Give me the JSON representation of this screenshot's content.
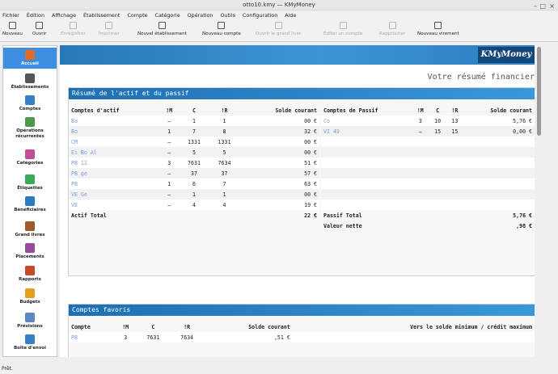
{
  "window": {
    "title": "otto10.kmy — KMyMoney"
  },
  "menu": [
    "Fichier",
    "Édition",
    "Affichage",
    "Établissement",
    "Compte",
    "Catégorie",
    "Opération",
    "Outils",
    "Configuration",
    "Aide"
  ],
  "toolbar": [
    {
      "label": "Nouveau",
      "enabled": true,
      "icon": "new-icon"
    },
    {
      "label": "Ouvrir",
      "enabled": true,
      "icon": "open-icon"
    },
    {
      "label": "Enregistrer",
      "enabled": false,
      "icon": "save-icon"
    },
    {
      "label": "Imprimer",
      "enabled": false,
      "icon": "print-icon"
    },
    {
      "label": "Nouvel établissement",
      "enabled": true,
      "icon": "institution-icon"
    },
    {
      "label": "Nouveau compte",
      "enabled": true,
      "icon": "account-icon"
    },
    {
      "label": "Ouvrir le grand livre",
      "enabled": false,
      "icon": "ledger-icon"
    },
    {
      "label": "Éditer un compte",
      "enabled": false,
      "icon": "edit-icon"
    },
    {
      "label": "Rapprocher",
      "enabled": false,
      "icon": "reconcile-icon"
    },
    {
      "label": "Nouveau virement",
      "enabled": true,
      "icon": "transfer-icon"
    }
  ],
  "sidebar": [
    {
      "label": "Accueil",
      "selected": true,
      "icon": "home-icon",
      "color": "#e06a2a"
    },
    {
      "label": "Établissements",
      "icon": "bank-icon",
      "color": "#555555"
    },
    {
      "label": "Comptes",
      "icon": "accounts-icon",
      "color": "#3a7fc4"
    },
    {
      "label": "Opérations récurrentes",
      "icon": "calendar-icon",
      "color": "#4a9a4a"
    },
    {
      "label": "Catégories",
      "icon": "categories-icon",
      "color": "#c44d9a"
    },
    {
      "label": "Étiquettes",
      "icon": "tag-icon",
      "color": "#3aa85a"
    },
    {
      "label": "Bénéficiaires",
      "icon": "payees-icon",
      "color": "#2a7ac4"
    },
    {
      "label": "Grand livres",
      "icon": "ledger-icon",
      "color": "#a05a2a"
    },
    {
      "label": "Placements",
      "icon": "investment-icon",
      "color": "#9a4a9a"
    },
    {
      "label": "Rapports",
      "icon": "reports-icon",
      "color": "#c44a2a"
    },
    {
      "label": "Budgets",
      "icon": "budget-icon",
      "color": "#e0a020"
    },
    {
      "label": "Prévisions",
      "icon": "forecast-icon",
      "color": "#5a8ac4"
    },
    {
      "label": "Boîte d'envoi",
      "icon": "outbox-icon",
      "color": "#3a7fc4"
    }
  ],
  "main": {
    "headline": "Votre résumé financier",
    "brand": "KMyMoney",
    "summary": {
      "title": "Résumé de l'actif et du passif",
      "asset_headers": [
        "Comptes d'actif",
        "!M",
        "C",
        "!R",
        "Solde courant"
      ],
      "liability_headers": [
        "Comptes de Passif",
        "!M",
        "C",
        "!R",
        "Solde courant"
      ],
      "assets": [
        {
          "name": "Ba",
          "m": "–",
          "c": "1",
          "r": "1",
          "bal": "00 €"
        },
        {
          "name": "Bo",
          "m": "1",
          "c": "7",
          "r": "8",
          "bal": "32 €"
        },
        {
          "name": "CM",
          "m": "–",
          "c": "1331",
          "r": "1331",
          "bal": "00 €"
        },
        {
          "name": "Ei Bo Al",
          "m": "–",
          "c": "5",
          "r": "5",
          "bal": "00 €"
        },
        {
          "name": "PB 11",
          "m": "3",
          "c": "7631",
          "r": "7634",
          "bal": "51 €"
        },
        {
          "name": "PB ge",
          "m": "–",
          "c": "37",
          "r": "37",
          "bal": "57 €"
        },
        {
          "name": "PB",
          "m": "1",
          "c": "6",
          "r": "7",
          "bal": "63 €"
        },
        {
          "name": "VE Ge",
          "m": "–",
          "c": "1",
          "r": "1",
          "bal": "00 €"
        },
        {
          "name": "VE",
          "m": "–",
          "c": "4",
          "r": "4",
          "bal": "19 €"
        }
      ],
      "asset_total": {
        "label": "Actif Total",
        "bal": "22 €"
      },
      "liabilities": [
        {
          "name": "Co",
          "m": "3",
          "c": "10",
          "r": "13",
          "bal": "5,76 €"
        },
        {
          "name": "VI 49",
          "m": "–",
          "c": "15",
          "r": "15",
          "bal": "0,00 €"
        }
      ],
      "liability_total": {
        "label": "Passif Total",
        "bal": "5,76 €"
      },
      "net": {
        "label": "Valeur nette",
        "bal": ",98 €"
      }
    },
    "favorites": {
      "title": "Comptes favoris",
      "headers": [
        "Compte",
        "!M",
        "C",
        "!R",
        "Solde courant",
        "Vers le solde minimum / crédit maximum"
      ],
      "rows": [
        {
          "name": "PB",
          "m": "3",
          "c": "7631",
          "r": "7634",
          "bal": ",51 €",
          "min": ""
        }
      ]
    }
  },
  "status": "Prêt."
}
